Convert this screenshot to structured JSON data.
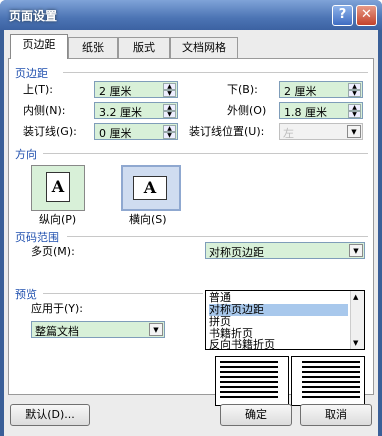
{
  "window": {
    "title": "页面设置",
    "help_label": "?",
    "close_label": "✕"
  },
  "tabs": [
    {
      "label": "页边距"
    },
    {
      "label": "纸张"
    },
    {
      "label": "版式"
    },
    {
      "label": "文档网格"
    }
  ],
  "margins": {
    "section": "页边距",
    "top_label": "上(T):",
    "top_value": "2 厘米",
    "bottom_label": "下(B):",
    "bottom_value": "2 厘米",
    "inside_label": "内侧(N):",
    "inside_value": "3.2 厘米",
    "outside_label": "外侧(O)",
    "outside_value": "1.8 厘米",
    "gutter_label": "装订线(G):",
    "gutter_value": "0 厘米",
    "gutter_pos_label": "装订线位置(U):",
    "gutter_pos_value": "左"
  },
  "orientation": {
    "section": "方向",
    "portrait_label": "纵向(P)",
    "landscape_label": "横向(S)",
    "icon_letter": "A"
  },
  "pages": {
    "section": "页码范围",
    "multiple_label": "多页(M):",
    "multiple_value": "对称页边距",
    "options": [
      "普通",
      "对称页边距",
      "拼页",
      "书籍折页",
      "反向书籍折页"
    ],
    "highlighted_index": 1
  },
  "preview": {
    "section": "预览",
    "apply_label": "应用于(Y):",
    "apply_value": "整篇文档"
  },
  "buttons": {
    "default": "默认(D)...",
    "ok": "确定",
    "cancel": "取消"
  }
}
